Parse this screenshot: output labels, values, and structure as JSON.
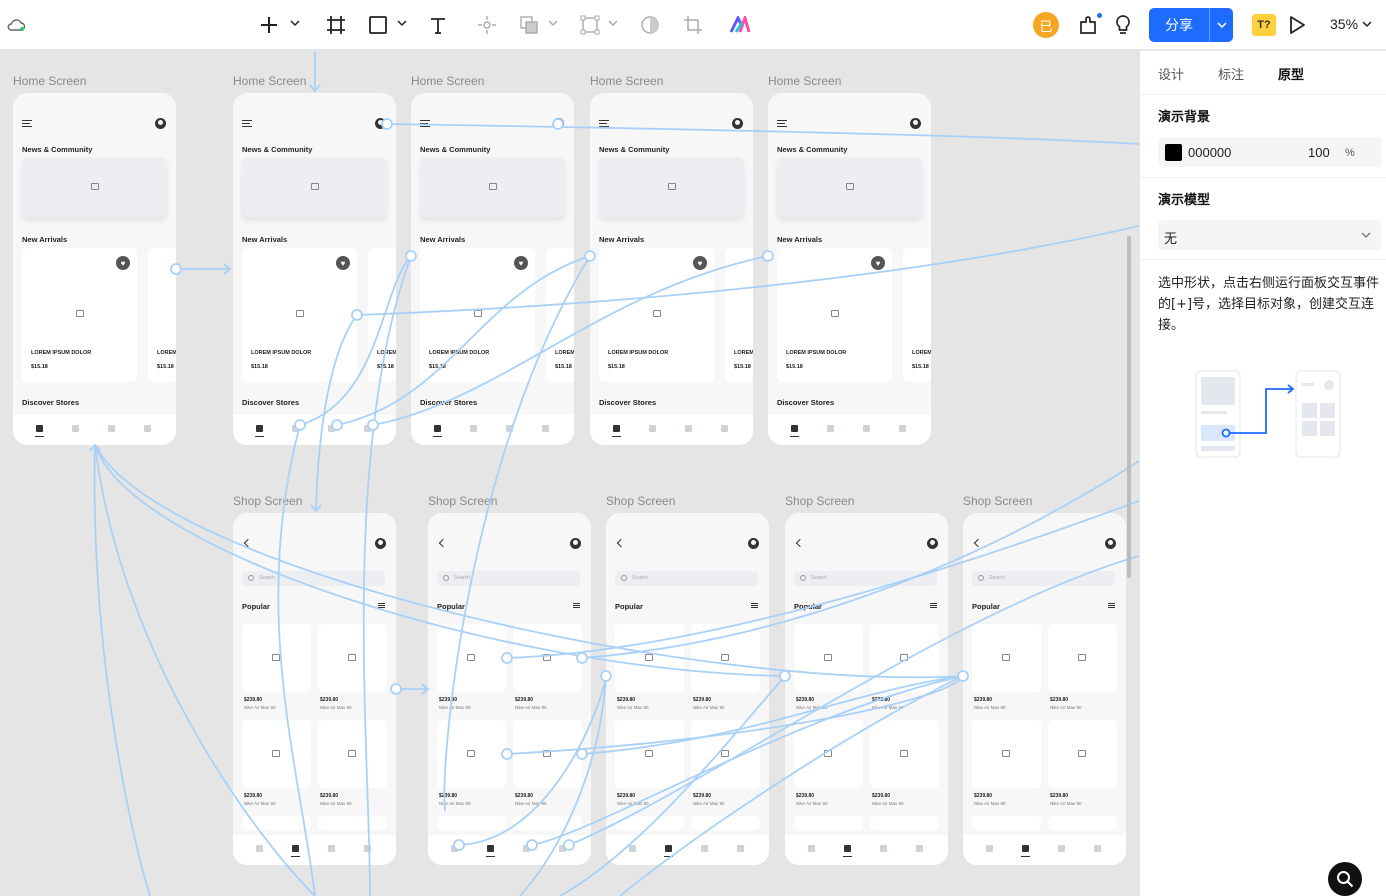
{
  "toolbar": {
    "zoom": "35%",
    "share_label": "分享",
    "avatar_initial": "已",
    "text_badge": "T?"
  },
  "panel": {
    "tabs": [
      "设计",
      "标注",
      "原型"
    ],
    "active_tab": "原型",
    "bg_section": "演示背景",
    "bg_color": "000000",
    "bg_opacity": "100",
    "bg_unit": "%",
    "model_section": "演示模型",
    "model_value": "无",
    "hint": "选中形状，点击右侧运行面板交互事件的[+]号，选择目标对象，创建交互连接。"
  },
  "home": {
    "label": "Home Screen",
    "title": "News & Community",
    "new_arrivals": "New Arrivals",
    "product_name": "LOREM IPSUM DOLOR",
    "product_price": "$15.18",
    "discover": "Discover Stores"
  },
  "shop": {
    "label": "Shop Screen",
    "search_placeholder": "Search",
    "popular": "Popular",
    "tile_price": "$239.80",
    "tile_name": "Nike Air Max 90"
  },
  "colors": {
    "accent": "#1e6bff",
    "wire": "#a9d1f7",
    "canvas": "#e5e5e5"
  }
}
